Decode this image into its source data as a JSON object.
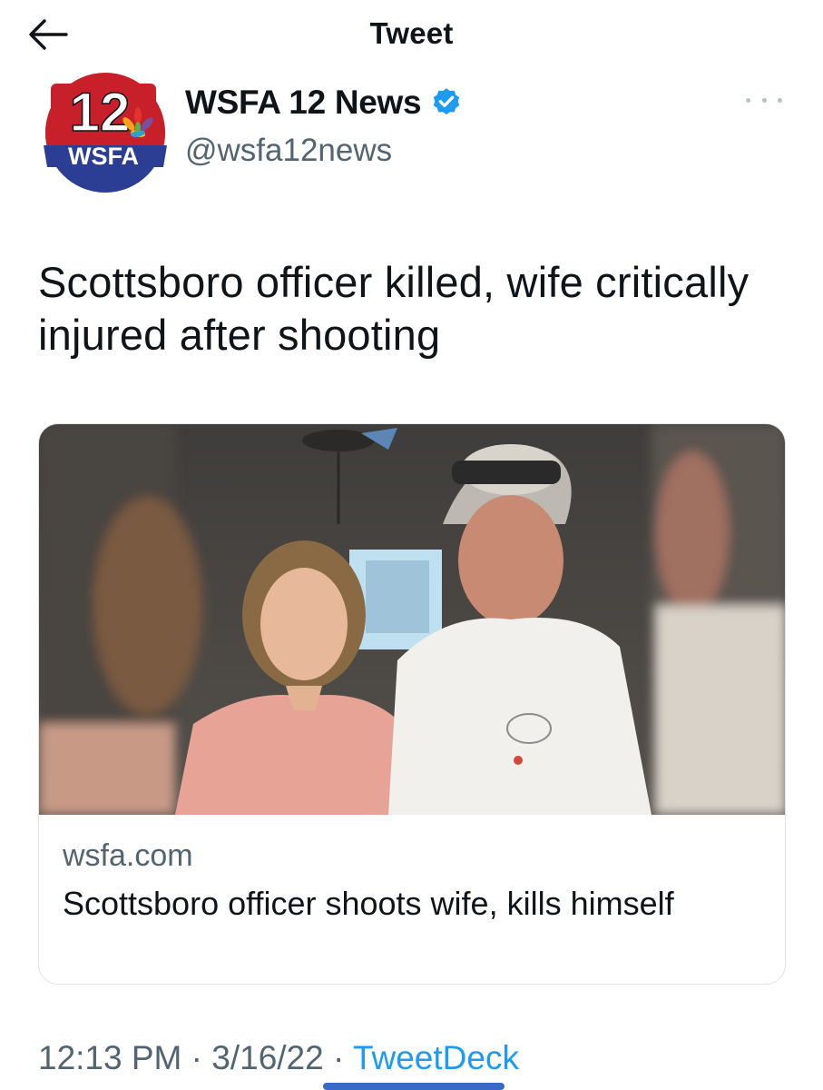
{
  "header": {
    "title": "Tweet",
    "back_icon": "back-arrow-icon"
  },
  "author": {
    "display_name": "WSFA 12 News",
    "handle": "@wsfa12news",
    "verified": true,
    "avatar": {
      "channel_number": "12",
      "station": "WSFA"
    }
  },
  "tweet": {
    "text": "Scottsboro officer killed, wife critically injured after shooting"
  },
  "link_card": {
    "domain": "wsfa.com",
    "title": "Scottsboro officer shoots wife, kills himself"
  },
  "meta": {
    "time": "12:13 PM",
    "separator": "·",
    "date": "3/16/22",
    "source": "TweetDeck"
  },
  "colors": {
    "accent": "#1d9bf0",
    "secondary_text": "#536471",
    "wsfa_red": "#c8202a",
    "wsfa_blue": "#2b3e93"
  }
}
